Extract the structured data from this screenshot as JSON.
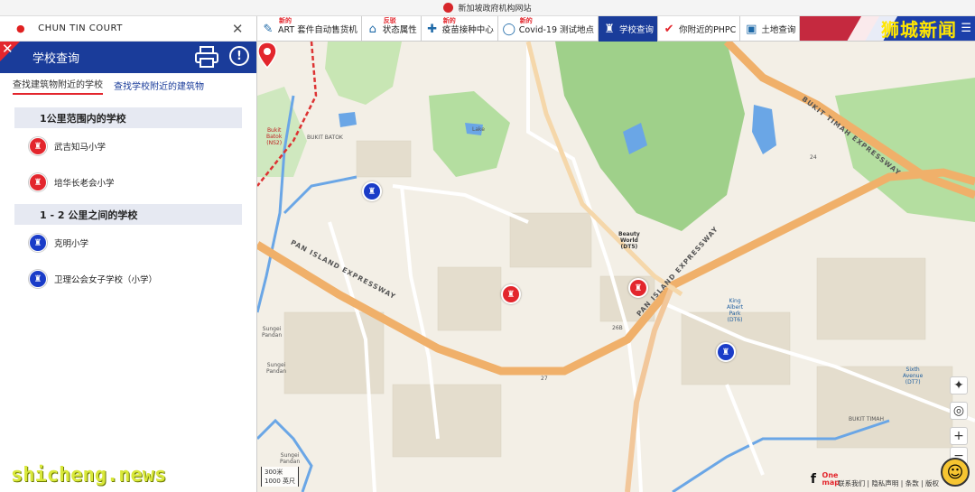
{
  "gov_banner": {
    "text": "新加坡政府机构网站"
  },
  "search": {
    "value": "CHUN TIN COURT",
    "pin_icon": "location-pin-icon",
    "clear_icon": "close-icon"
  },
  "panel": {
    "title": "学校查询",
    "tabs": [
      {
        "label": "查找建筑物附近的学校",
        "active": true
      },
      {
        "label": "查找学校附近的建筑物",
        "active": false
      }
    ],
    "sections": [
      {
        "heading": "1公里范围内的学校",
        "schools": [
          {
            "name": "武吉知马小学",
            "color": "red"
          },
          {
            "name": "培华长老会小学",
            "color": "red"
          }
        ]
      },
      {
        "heading": "1 - 2 公里之间的学校",
        "schools": [
          {
            "name": "克明小学",
            "color": "blue"
          },
          {
            "name": "卫理公会女子学校（小学）",
            "color": "blue"
          }
        ]
      }
    ]
  },
  "toolbar": {
    "items": [
      {
        "label": "ART 套件自动售货机",
        "new": "新的",
        "icon": "vending-icon"
      },
      {
        "label": "状态属性",
        "new": "反驳",
        "icon": "building-icon"
      },
      {
        "label": "疫苗接种中心",
        "new": "新的",
        "icon": "syringe-icon"
      },
      {
        "label": "Covid-19 测试地点",
        "new": "新的",
        "icon": "test-icon"
      },
      {
        "label": "学校查询",
        "new": "",
        "icon": "school-icon",
        "active": true
      },
      {
        "label": "你附近的PHPC",
        "new": "",
        "icon": "phpc-icon"
      },
      {
        "label": "土地查询",
        "new": "",
        "icon": "land-icon"
      }
    ],
    "brand": "狮城新闻"
  },
  "map": {
    "labels": {
      "bukit_batok_station": "Bukit\nBatok\n(NS2)",
      "bukit_batok": "BUKIT BATOK",
      "beauty_world": "Beauty\nWorld\n(DT5)",
      "king_albert_park": "King\nAlbert\nPark\n(DT6)",
      "sixth_avenue": "Sixth\nAvenue\n(DT7)",
      "bukit_timah": "BUKIT TIMAH",
      "pie": "PAN ISLAND EXPRESSWAY",
      "pie2": "PAN ISLAND EXPRESSWAY",
      "bke": "BUKIT TIMAH EXPRESSWAY",
      "sungei_pandan": "Sungei\nPandan",
      "sungei_pandan2": "Sungei\nPandan",
      "sungei_pandan3": "Sungei\nPandan",
      "lake": "Lake",
      "rd24": "24",
      "rd26b": "26B",
      "rd27": "27"
    },
    "scale": {
      "top": "300米",
      "bottom": "1000 英尺"
    },
    "footer": "联系我们 | 隐私声明 | 条款 | 版权",
    "facebook": "f",
    "onemap": "One\nmap"
  },
  "watermark": "shicheng.news",
  "colors": {
    "primary": "#1a3c9a",
    "accent": "#e3262d",
    "school_red": "#e3262d",
    "school_blue": "#1a3cc8"
  }
}
